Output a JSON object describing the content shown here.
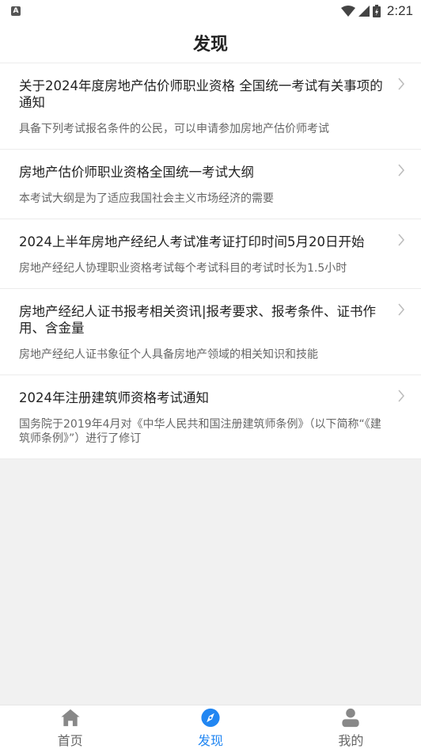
{
  "status_bar": {
    "notification_icon": "A",
    "icons": [
      "wifi-icon",
      "signal-icon",
      "battery-charging-icon"
    ],
    "time": "2:21"
  },
  "header": {
    "title": "发现"
  },
  "articles": [
    {
      "title": "关于2024年度房地产估价师职业资格 全国统一考试有关事项的通知",
      "desc": "具备下列考试报名条件的公民，可以申请参加房地产估价师考试"
    },
    {
      "title": "房地产估价师职业资格全国统一考试大纲",
      "desc": "本考试大纲是为了适应我国社会主义市场经济的需要"
    },
    {
      "title": "2024上半年房地产经纪人考试准考证打印时间5月20日开始",
      "desc": "房地产经纪人协理职业资格考试每个考试科目的考试时长为1.5小时"
    },
    {
      "title": "房地产经纪人证书报考相关资讯|报考要求、报考条件、证书作用、含金量",
      "desc": "房地产经纪人证书象征个人具备房地产领域的相关知识和技能"
    },
    {
      "title": "2024年注册建筑师资格考试通知",
      "desc": "国务院于2019年4月对《中华人民共和国注册建筑师条例》（以下简称“《建筑师条例》”）进行了修订"
    }
  ],
  "tabbar": {
    "tabs": [
      {
        "label": "首页",
        "icon": "home-icon",
        "active": false
      },
      {
        "label": "发现",
        "icon": "compass-icon",
        "active": true
      },
      {
        "label": "我的",
        "icon": "user-icon",
        "active": false
      }
    ]
  },
  "colors": {
    "accent": "#2186f2",
    "inactive": "#888888",
    "background": "#f1f1f1"
  }
}
